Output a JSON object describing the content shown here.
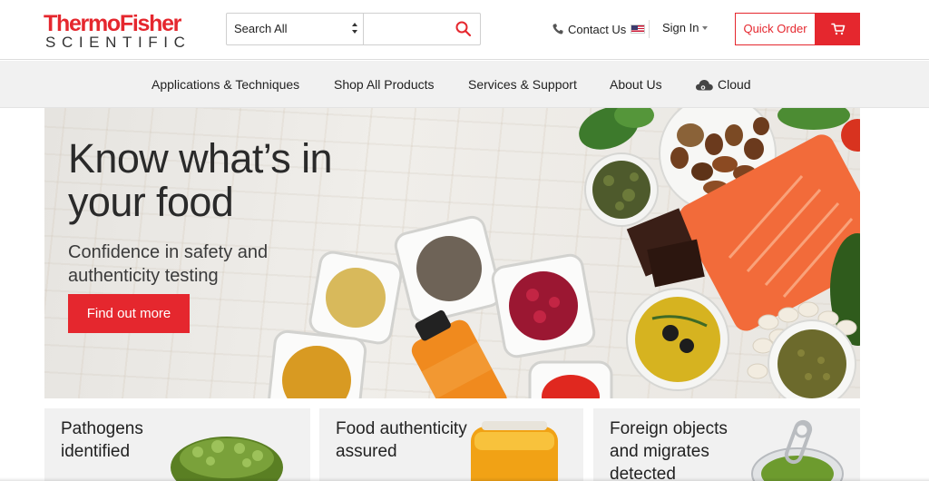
{
  "brand": {
    "logo_line1": "ThermoFisher",
    "logo_line2": "SCIENTIFIC",
    "accent_color": "#e5272e"
  },
  "header": {
    "search_category": "Search All",
    "search_placeholder": "",
    "contact_label": "Contact Us",
    "signin_label": "Sign In",
    "quick_order_label": "Quick Order",
    "icons": [
      "phone-icon",
      "us-flag-icon",
      "search-icon",
      "cart-icon"
    ]
  },
  "nav": {
    "items": [
      {
        "label": "Applications & Techniques"
      },
      {
        "label": "Shop All Products"
      },
      {
        "label": "Services & Support"
      },
      {
        "label": "About Us"
      },
      {
        "label": "Cloud"
      }
    ]
  },
  "hero": {
    "title_line1": "Know what’s in",
    "title_line2": "your food",
    "subtitle_line1": "Confidence in safety and",
    "subtitle_line2": "authenticity testing",
    "cta_label": "Find out more"
  },
  "cards": [
    {
      "line1": "Pathogens",
      "line2": "identified",
      "line3": ""
    },
    {
      "line1": "Food authenticity",
      "line2": "assured",
      "line3": ""
    },
    {
      "line1": "Foreign objects",
      "line2": "and migrates",
      "line3": "detected"
    }
  ]
}
